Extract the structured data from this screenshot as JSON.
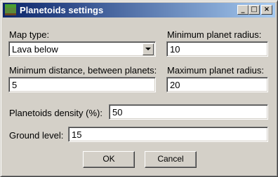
{
  "window": {
    "title": "Planetoids settings",
    "minimize_label": "_",
    "maximize_label": "□",
    "close_label": "×"
  },
  "form": {
    "map_type": {
      "label": "Map type:",
      "value": "Lava below"
    },
    "min_planet_radius": {
      "label": "Minimum planet radius:",
      "value": "10"
    },
    "min_distance": {
      "label": "Minimum distance, between planets:",
      "value": "5"
    },
    "max_planet_radius": {
      "label": "Maximum planet radius:",
      "value": "20"
    },
    "density": {
      "label": "Planetoids density (%):",
      "value": "50"
    },
    "ground_level": {
      "label": "Ground level:",
      "value": "15"
    }
  },
  "buttons": {
    "ok": "OK",
    "cancel": "Cancel"
  }
}
